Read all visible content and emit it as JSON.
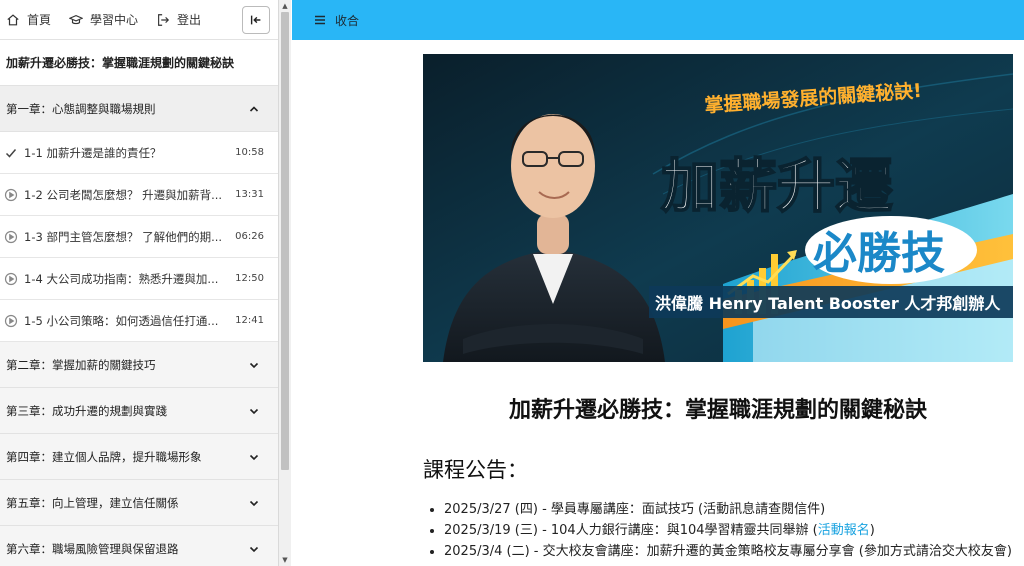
{
  "topnav": {
    "home": "首頁",
    "learning_center": "學習中心",
    "logout": "登出"
  },
  "sidebar": {
    "course_title": "加薪升遷必勝技：掌握職涯規劃的關鍵秘訣",
    "chapters": [
      {
        "title": "第一章：心態調整與職場規則",
        "expanded": true,
        "lessons": [
          {
            "title": "1-1 加薪升遷是誰的責任？",
            "duration": "10:58",
            "status": "completed"
          },
          {
            "title": "1-2 公司老闆怎麼想？ 升遷與加薪背...",
            "duration": "13:31",
            "status": "unwatched"
          },
          {
            "title": "1-3 部門主管怎麼想？ 了解他們的期...",
            "duration": "06:26",
            "status": "unwatched"
          },
          {
            "title": "1-4 大公司成功指南：熟悉升遷與加...",
            "duration": "12:50",
            "status": "unwatched"
          },
          {
            "title": "1-5 小公司策略：如何透過信任打通...",
            "duration": "12:41",
            "status": "unwatched"
          }
        ]
      },
      {
        "title": "第二章：掌握加薪的關鍵技巧",
        "expanded": false
      },
      {
        "title": "第三章：成功升遷的規劃與實踐",
        "expanded": false
      },
      {
        "title": "第四章：建立個人品牌，提升職場形象",
        "expanded": false
      },
      {
        "title": "第五章：向上管理，建立信任關係",
        "expanded": false
      },
      {
        "title": "第六章：職場風險管理與保留退路",
        "expanded": false
      }
    ]
  },
  "main": {
    "collapse_label": "收合",
    "banner": {
      "tagline": "掌握職場發展的關鍵秘訣!",
      "title_main": "加薪升遷",
      "title_sub": "必勝技",
      "presenter": "洪偉騰 Henry Talent Booster 人才邦創辦人"
    },
    "page_title": "加薪升遷必勝技：掌握職涯規劃的關鍵秘訣",
    "notice_heading": "課程公告：",
    "notices": [
      {
        "text": "2025/3/27 (四) - 學員專屬講座：面試技巧 (活動訊息請查閱信件)",
        "link": "",
        "after": ""
      },
      {
        "text": "2025/3/19 (三) - 104人力銀行講座：與104學習精靈共同舉辦 (",
        "link": "活動報名",
        "after": ")"
      },
      {
        "text": "2025/3/4 (二) - 交大校友會講座：加薪升遷的黃金策略校友專屬分享會 (參加方式請洽交大校友會)",
        "link": "",
        "after": ""
      }
    ]
  },
  "colors": {
    "topbar": "#29b6f6",
    "link": "#1aa3e0",
    "banner_bg": "#0d2f3f",
    "banner_accent": "#f7941d"
  }
}
